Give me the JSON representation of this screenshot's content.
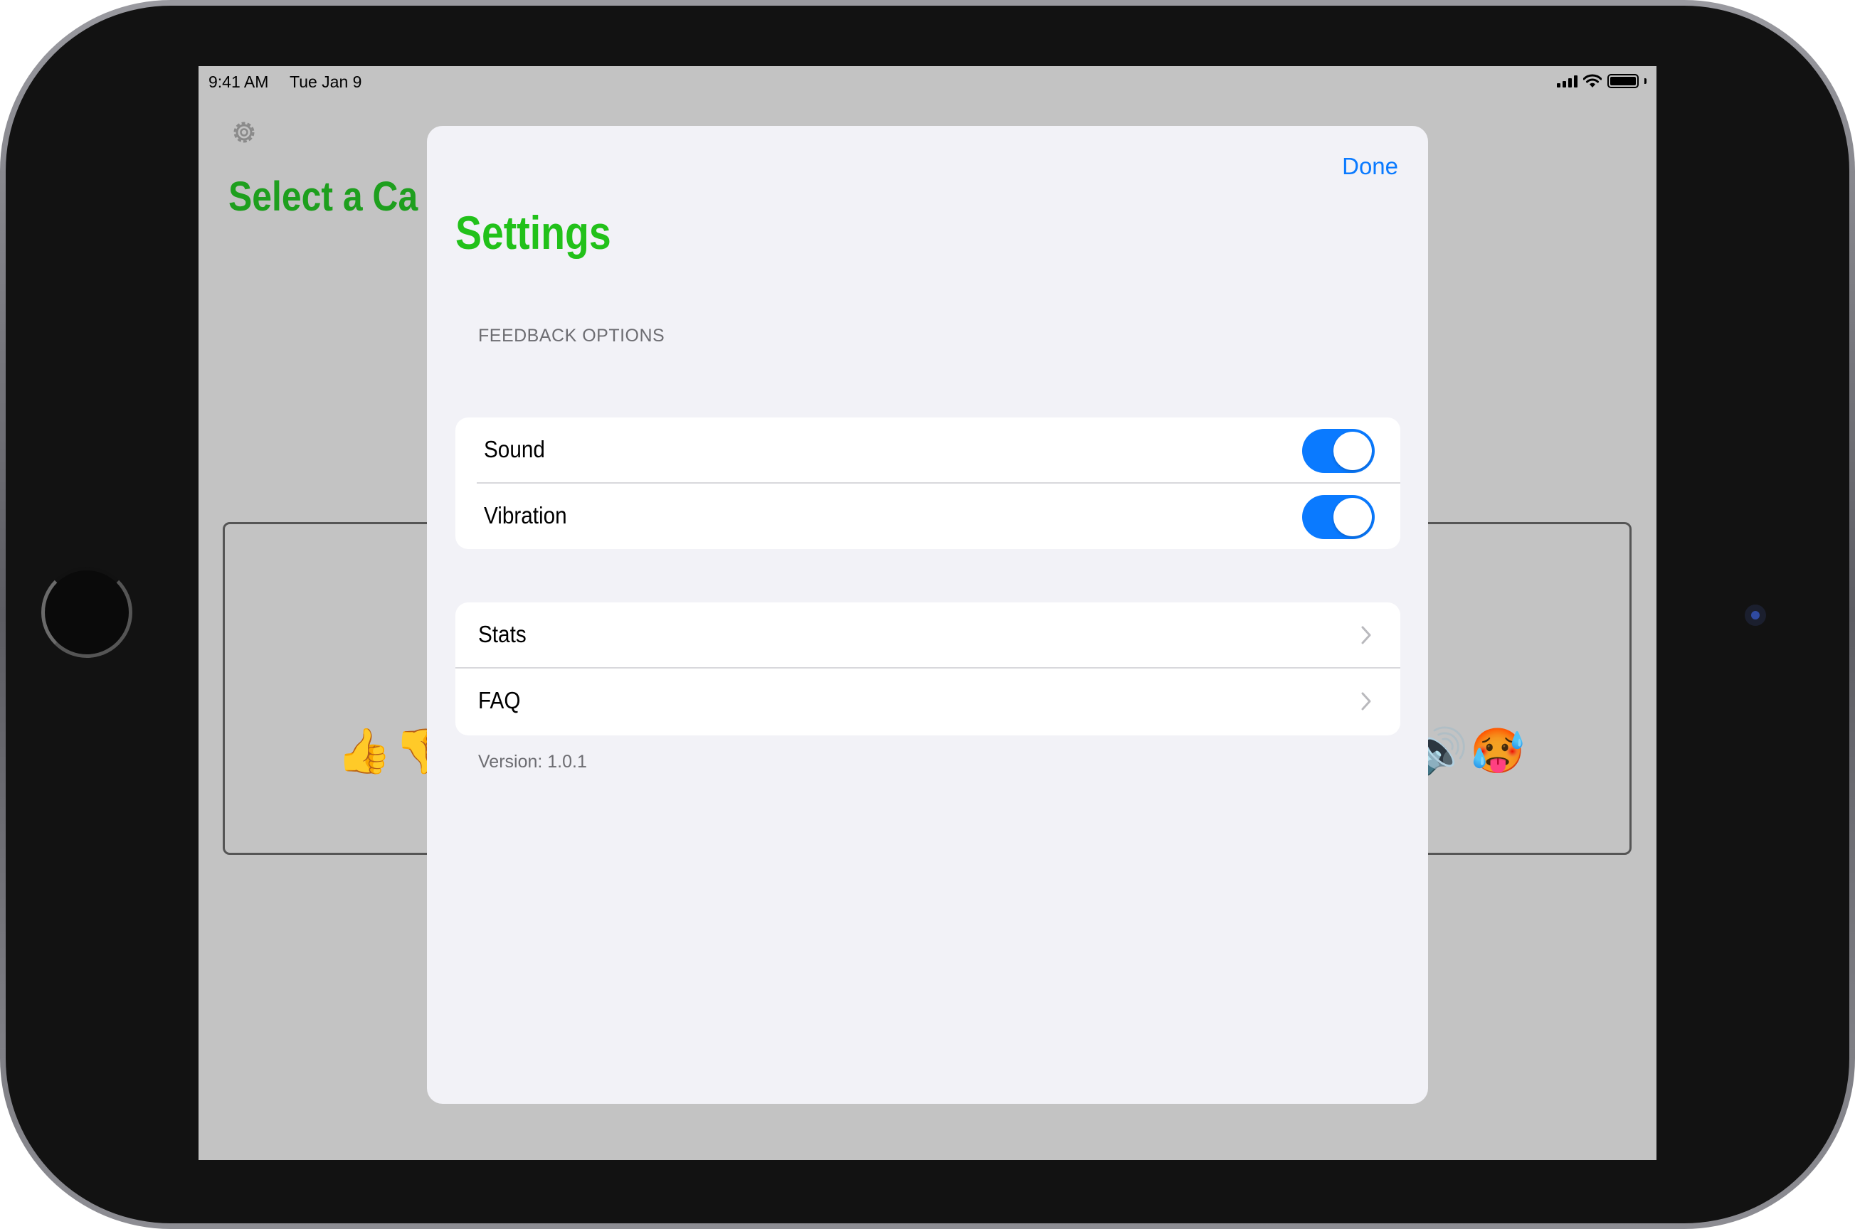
{
  "status_bar": {
    "time": "9:41 AM",
    "date": "Tue Jan 9"
  },
  "background": {
    "title": "Select a Ca",
    "emojis_left": [
      "👍",
      "👎"
    ],
    "emojis_right": [
      "🔊",
      "🥵"
    ]
  },
  "modal": {
    "done_label": "Done",
    "title": "Settings",
    "feedback_section": {
      "header": "FEEDBACK OPTIONS",
      "sound_label": "Sound",
      "sound_enabled": true,
      "vibration_label": "Vibration",
      "vibration_enabled": true
    },
    "links": {
      "stats_label": "Stats",
      "faq_label": "FAQ"
    },
    "version": "Version: 1.0.1"
  },
  "colors": {
    "accent": "#0a7aff",
    "title_green": "#22c11a",
    "sheet_background": "#f2f2f7"
  }
}
